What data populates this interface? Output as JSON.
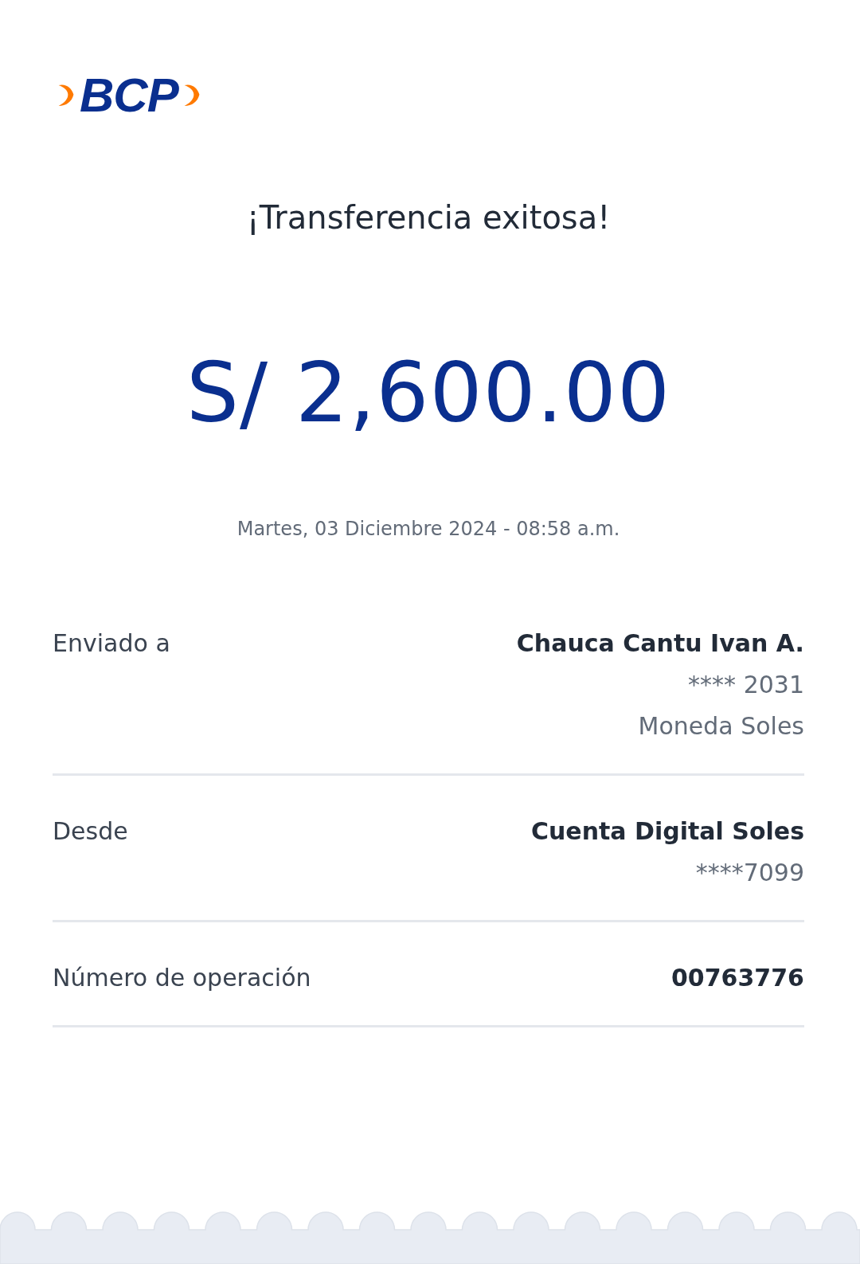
{
  "logo": {
    "text": "BCP"
  },
  "title": "¡Transferencia exitosa!",
  "amount": "S/ 2,600.00",
  "datetime": "Martes, 03 Diciembre 2024 - 08:58 a.m.",
  "details": [
    {
      "label": "Enviado a",
      "values": [
        {
          "text": "Chauca Cantu Ivan A.",
          "kind": "strong"
        },
        {
          "text": "**** 2031",
          "kind": "normal"
        },
        {
          "text": "Moneda Soles",
          "kind": "normal"
        }
      ]
    },
    {
      "label": "Desde",
      "values": [
        {
          "text": "Cuenta Digital Soles",
          "kind": "strong"
        },
        {
          "text": "****7099",
          "kind": "normal"
        }
      ]
    },
    {
      "label": "Número de operación",
      "values": [
        {
          "text": "00763776",
          "kind": "strong"
        }
      ]
    }
  ]
}
